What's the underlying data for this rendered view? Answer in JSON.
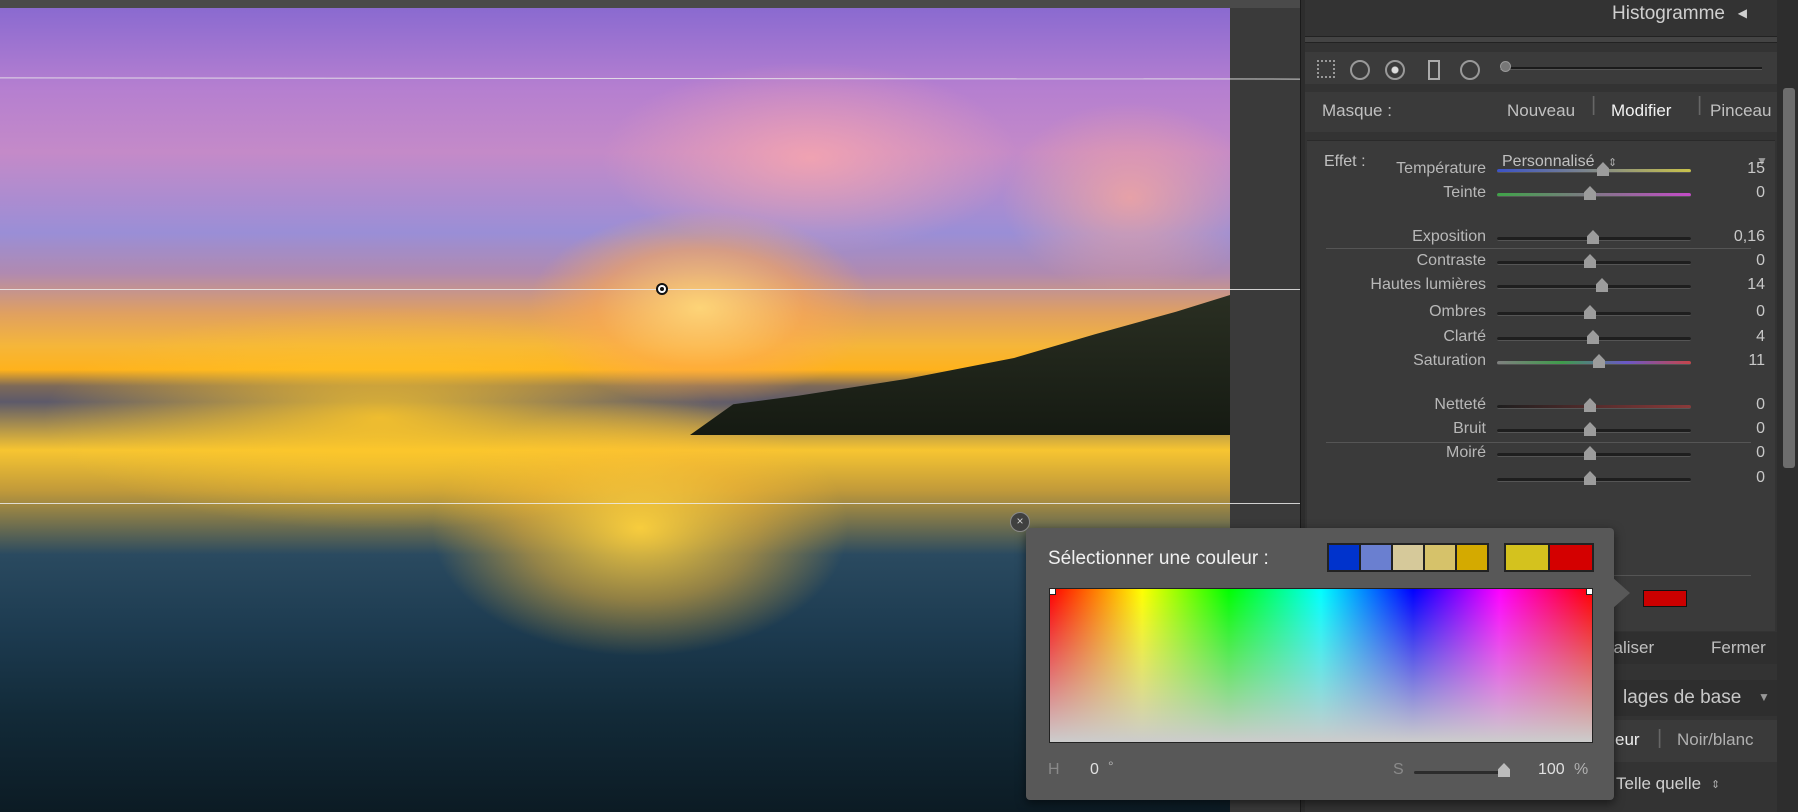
{
  "histogram": {
    "title": "Histogramme"
  },
  "mask": {
    "label": "Masque :",
    "new": "Nouveau",
    "edit": "Modifier",
    "brush": "Pinceau"
  },
  "effect": {
    "label": "Effet :",
    "preset": "Personnalisé"
  },
  "sliders": [
    {
      "label": "Température",
      "value": "15"
    },
    {
      "label": "Teinte",
      "value": "0"
    },
    {
      "label": "Exposition",
      "value": "0,16"
    },
    {
      "label": "Contraste",
      "value": "0"
    },
    {
      "label": "Hautes lumières",
      "value": "14"
    },
    {
      "label": "Ombres",
      "value": "0"
    },
    {
      "label": "Clarté",
      "value": "4"
    },
    {
      "label": "Saturation",
      "value": "11"
    },
    {
      "label": "Netteté",
      "value": "0"
    },
    {
      "label": "Bruit",
      "value": "0"
    },
    {
      "label": "Moiré",
      "value": "0"
    },
    {
      "label": "",
      "value": "0"
    }
  ],
  "footer": {
    "reset": "tialiser",
    "close": "Fermer"
  },
  "basic": {
    "title": "lages de base",
    "tab_color": "eur",
    "tab_bw": "Noir/blanc",
    "treatment": "Telle quelle"
  },
  "picker": {
    "title": "Sélectionner une couleur :",
    "h_label": "H",
    "h_value": "0",
    "h_unit": "°",
    "s_label": "S",
    "s_value": "100",
    "s_unit": "%",
    "close_glyph": "×",
    "s_level": 1.0
  },
  "swatches_a": [
    "#0033cc",
    "#6a7fd0",
    "#d6c99a",
    "#d6c26a",
    "#d4aa00"
  ],
  "swatches_b": [
    "#d4c21e",
    "#d40000"
  ],
  "selected_color": "#cc0000",
  "icons": [
    "marquee-icon",
    "circle-plus-icon",
    "dot-circle-icon",
    "rectangle-icon",
    "circle-icon"
  ],
  "colors": {
    "accent": "#cc0000"
  }
}
